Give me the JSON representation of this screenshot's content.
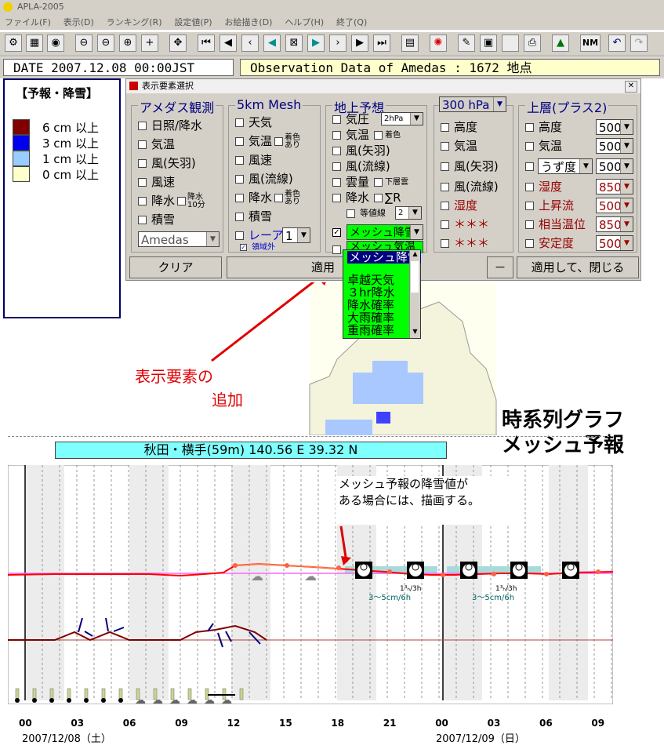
{
  "app": {
    "title": "APLA-2005"
  },
  "menu": [
    "ファイル(F)",
    "表示(D)",
    "ランキング(R)",
    "設定値(P)",
    "お絵描き(D)",
    "ヘルプ(H)",
    "終了(Q)"
  ],
  "toolbar": {
    "nm_label": "NM"
  },
  "header": {
    "date": "DATE 2007.12.08  00:00JST",
    "observation": "Observation Data of Amedas : 1672 地点"
  },
  "legend": {
    "title": "【予報・降雪】",
    "items": [
      {
        "label": "6 cm 以上",
        "color": "#800000"
      },
      {
        "label": "3 cm 以上",
        "color": "#0000ee"
      },
      {
        "label": "1 cm 以上",
        "color": "#99ccff"
      },
      {
        "label": "0 cm 以上",
        "color": "#ffffcc"
      }
    ]
  },
  "dialog": {
    "title": "表示要素選択",
    "groups": {
      "amedas": {
        "title": "アメダス観測",
        "items": [
          "日照/降水",
          "気温",
          "風(矢羽)",
          "風速",
          "降水",
          "積雪"
        ],
        "rain10_label": "降水\n10分",
        "select": "Amedas"
      },
      "mesh": {
        "title": "5km Mesh",
        "items": [
          "天気",
          "気温",
          "風速",
          "風(流線)",
          "降水",
          "積雪"
        ],
        "colored_label": "着色\nあり",
        "radar_label": "レーアメ",
        "radar_value": "1",
        "region_label": "領域外"
      },
      "ground": {
        "title": "地上予想",
        "items": [
          "気圧",
          "気温",
          "風(矢羽)",
          "風(流線)",
          "雲量",
          "降水"
        ],
        "pressure_step": "2hPa",
        "colored_label": "着色",
        "lower_cloud_label": "下層雲",
        "sum_label": "∑R",
        "isoline_label": "等値線",
        "isoline_value": "2",
        "selected_element": "メッシュ降雪",
        "second_element": "メッシュ気温"
      },
      "level": {
        "select": "300 hPa",
        "items": [
          "高度",
          "気温",
          "風(矢羽)",
          "風(流線)",
          "湿度",
          "＊＊＊",
          "＊＊＊"
        ]
      },
      "upper": {
        "title": "上層(プラス2)",
        "items": [
          "高度",
          "気温",
          "うず度",
          "湿度",
          "上昇流",
          "相当温位",
          "安定度"
        ],
        "values": [
          "500",
          "500",
          "500",
          "850",
          "500",
          "850",
          "500"
        ]
      }
    },
    "buttons": {
      "clear": "クリア",
      "apply": "適用",
      "minus": "－",
      "apply_close": "適用して、閉じる"
    },
    "dropdown_options": [
      "メッシュ降雪",
      "卓越天気",
      "３hr降水",
      "降水確率",
      "大雨確率",
      "重雨確率"
    ]
  },
  "annotations": {
    "add_element": [
      "表示要素の",
      "追加"
    ],
    "big_title": [
      "時系列グラフ",
      "メッシュ予報"
    ],
    "note": [
      "メッシュ予報の降雪値が",
      "ある場合には、描画する。"
    ]
  },
  "station": {
    "label": "秋田・横手(59m) 140.56 E  39.32 N"
  },
  "timeline": {
    "hour_labels": [
      "00",
      "03",
      "06",
      "09",
      "12",
      "15",
      "18",
      "21",
      "00",
      "03",
      "06",
      "09"
    ],
    "dates": [
      "2007/12/08（土）",
      "2007/12/09（日）"
    ],
    "snow_labels": [
      "1³ₕ/3h",
      "3～5cm/6h",
      "1³ₕ/3h",
      "3～5cm/6h"
    ]
  },
  "chart_data": {
    "type": "line",
    "series": [],
    "x": [
      "00",
      "03",
      "06",
      "09",
      "12",
      "15",
      "18",
      "21",
      "00",
      "03",
      "06",
      "09"
    ]
  }
}
